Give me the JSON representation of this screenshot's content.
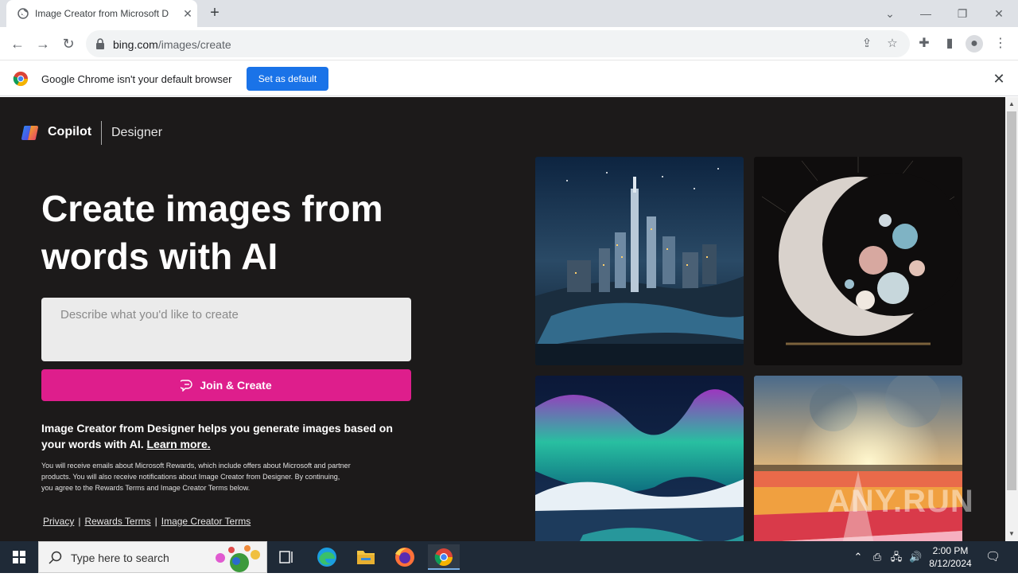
{
  "browser": {
    "tab_title": "Image Creator from Microsoft D",
    "url_host": "bing.com",
    "url_path": "/images/create"
  },
  "infobar": {
    "message": "Google Chrome isn't your default browser",
    "button": "Set as default"
  },
  "brand": {
    "copilot": "Copilot",
    "designer": "Designer"
  },
  "hero": {
    "headline": "Create images from words with AI",
    "prompt_placeholder": "Describe what you'd like to create",
    "join_button": "Join & Create"
  },
  "description": {
    "text": "Image Creator from Designer helps you generate images based on your words with AI.",
    "learn_more": "Learn more."
  },
  "fine_print": "You will receive emails about Microsoft Rewards, which include offers about Microsoft and partner products. You will also receive notifications about Image Creator from Designer. By continuing, you agree to the Rewards Terms and Image Creator Terms below.",
  "footer_links": [
    "Privacy",
    "Rewards Terms",
    "Image Creator Terms"
  ],
  "gallery": [
    "night city skyline",
    "crescent moon with flowers",
    "northern lights",
    "tulip field at sunset"
  ],
  "watermark": "ANY.RUN",
  "taskbar": {
    "search_placeholder": "Type here to search",
    "time": "2:00 PM",
    "date": "8/12/2024"
  },
  "colors": {
    "page_bg": "#1c1a1a",
    "join_button": "#de1e8c",
    "chrome_blue": "#1a73e8"
  }
}
